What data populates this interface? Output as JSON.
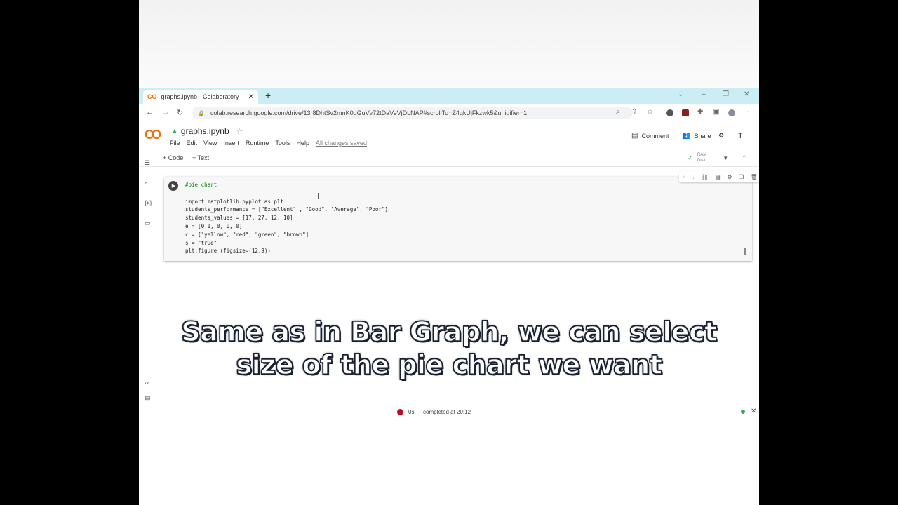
{
  "browser": {
    "tab_title": "graphs.ipynb - Colaboratory",
    "tab_icon": "CO",
    "url": "colab.research.google.com/drive/13r8DhtSv2mnK0dGuVv72tDaVeVjDLNAP#scrollTo=Z4qkUjFkzwk5&uniqifier=1"
  },
  "colab": {
    "logo": "CO",
    "notebook_title": "graphs.ipynb",
    "menu": [
      "File",
      "Edit",
      "View",
      "Insert",
      "Runtime",
      "Tools",
      "Help"
    ],
    "save_status": "All changes saved",
    "comment_label": "Comment",
    "share_label": "Share",
    "add_code": "+ Code",
    "add_text": "+ Text",
    "ram_label": "RAM",
    "disk_label": "Disk"
  },
  "cell": {
    "lines": [
      "#pie chart",
      "",
      "import matplotlib.pyplot as plt",
      "students_performance = [\"Excellent\" , \"Good\", \"Average\", \"Poor\"]",
      "students_values = [17, 27, 12, 10]",
      "e = [0.1, 0, 0, 0]",
      "c = [\"yellow\", \"red\", \"green\", \"brown\"]",
      "s = \"true\"",
      "plt.figure (figsize=(12,9))"
    ]
  },
  "caption": {
    "line1": "Same as in Bar Graph, we can select",
    "line2": "size of the pie chart we want"
  },
  "status": {
    "time": "0s",
    "completed": "completed at 20:12"
  },
  "colors": {
    "tab_strip": "#cbeef5",
    "status_error": "#b80f1d",
    "status_ok": "#34a853"
  }
}
